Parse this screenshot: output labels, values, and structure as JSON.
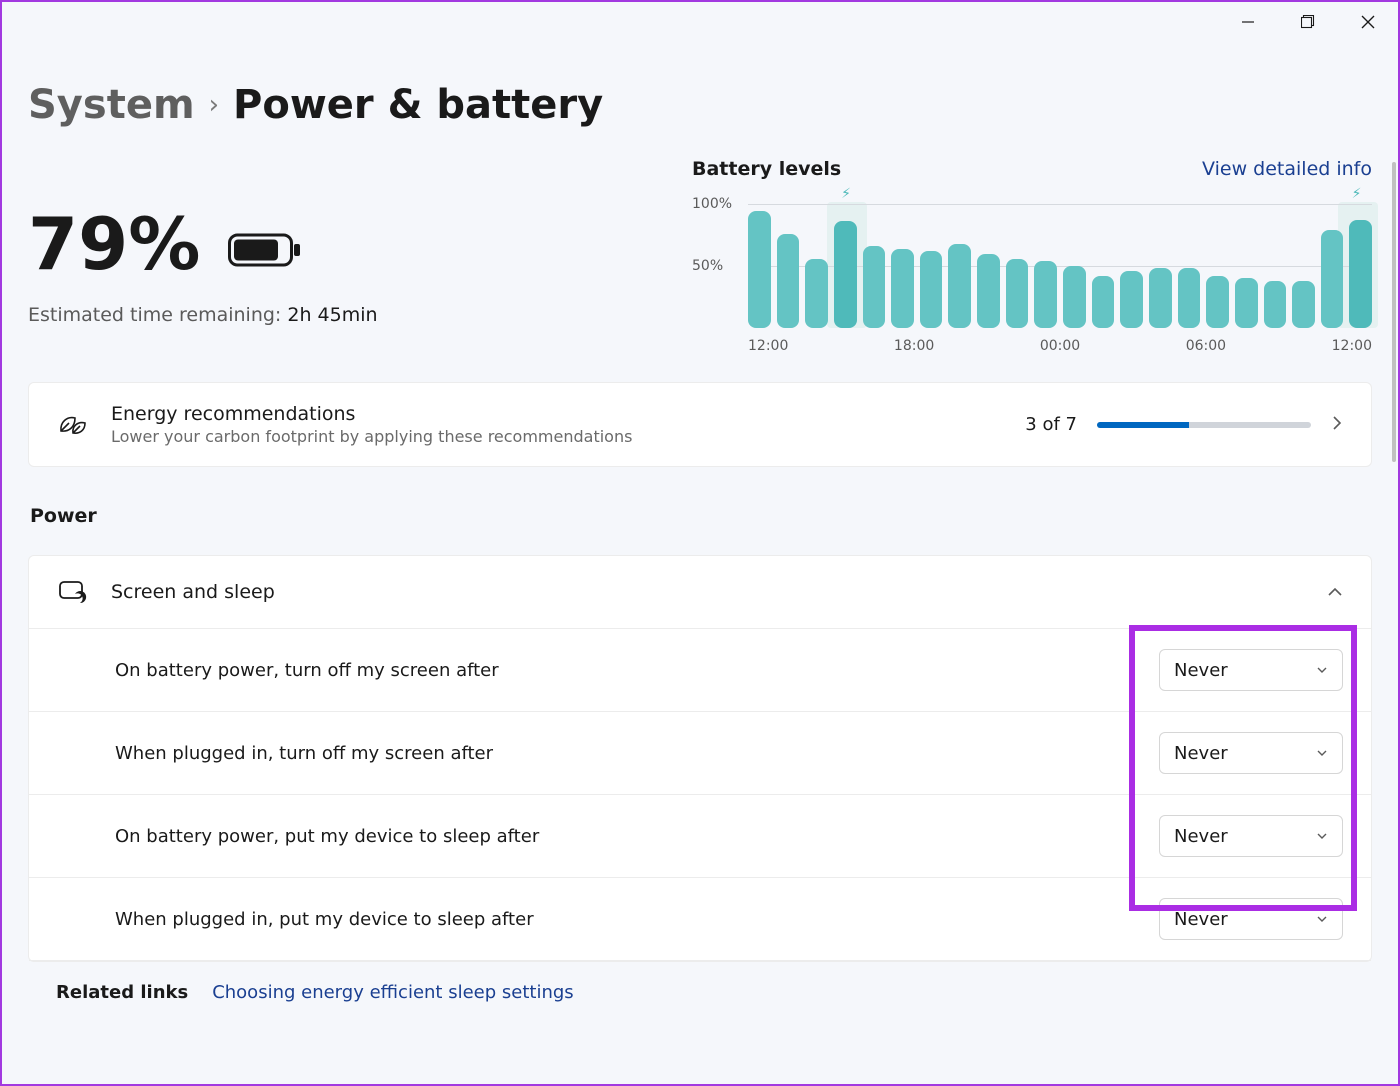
{
  "breadcrumb": {
    "root": "System",
    "current": "Power & battery"
  },
  "battery": {
    "percent": "79%",
    "estimate_label": "Estimated time remaining:",
    "estimate_value": "2h 45min"
  },
  "chart_data": {
    "type": "bar",
    "title": "Battery levels",
    "link": "View detailed info",
    "ylabel": "",
    "ylim": [
      0,
      100
    ],
    "yticks": [
      "100%",
      "50%"
    ],
    "categories": [
      "12:00",
      "18:00",
      "00:00",
      "06:00",
      "12:00"
    ],
    "values": [
      94,
      76,
      56,
      86,
      66,
      64,
      62,
      68,
      60,
      56,
      54,
      50,
      42,
      46,
      48,
      48,
      42,
      40,
      38,
      38,
      79,
      87
    ],
    "charge_markers": [
      3,
      21
    ]
  },
  "energy": {
    "title": "Energy recommendations",
    "desc": "Lower your carbon footprint by applying these recommendations",
    "count": "3 of 7",
    "progress_pct": 43
  },
  "section_power": "Power",
  "sleep": {
    "header": "Screen and sleep",
    "rows": [
      {
        "label": "On battery power, turn off my screen after",
        "value": "Never"
      },
      {
        "label": "When plugged in, turn off my screen after",
        "value": "Never"
      },
      {
        "label": "On battery power, put my device to sleep after",
        "value": "Never"
      },
      {
        "label": "When plugged in, put my device to sleep after",
        "value": "Never"
      }
    ]
  },
  "related": {
    "label": "Related links",
    "link": "Choosing energy efficient sleep settings"
  }
}
